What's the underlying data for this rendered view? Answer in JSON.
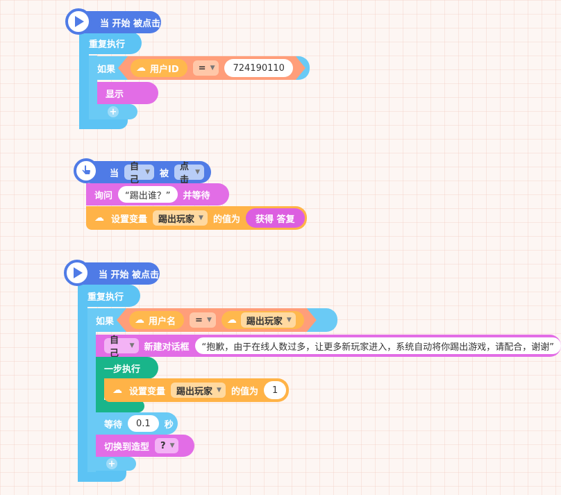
{
  "script1": {
    "hat_label": "当 开始 被点击",
    "repeat_label": "重复执行",
    "if_label": "如果",
    "var_name": "用户ID",
    "operator": "=",
    "compare_value": "724190110",
    "show_label": "显示"
  },
  "script2": {
    "when_label": "当",
    "target_dropdown": "自己",
    "is_label": "被",
    "action_dropdown": "点击",
    "ask_label": "询问",
    "ask_text": "“踢出谁？”",
    "ask_wait_label": "并等待",
    "set_var_label": "设置变量",
    "set_var_name": "踢出玩家",
    "value_label": "的值为",
    "answer_label": "获得 答复"
  },
  "script3": {
    "hat_label": "当 开始 被点击",
    "repeat_label": "重复执行",
    "if_label": "如果",
    "var_name": "用户名",
    "operator": "=",
    "compare_var": "踢出玩家",
    "dialog_target": "自己",
    "dialog_label": "新建对话框",
    "dialog_text": "“抱歉，由于在线人数过多，让更多新玩家进入，系统自动将你踢出游戏，请配合，谢谢”",
    "step_label": "一步执行",
    "set_var_label": "设置变量",
    "set_var_name": "踢出玩家",
    "value_label": "的值为",
    "set_value": "1",
    "wait_label": "等待",
    "wait_value": "0.1",
    "wait_unit": "秒",
    "switch_label": "切换到造型",
    "costume_value": "?"
  },
  "icons": {
    "play": "play-icon",
    "hand": "hand-pointer-icon",
    "cloud": "cloud-upload-icon",
    "add": "plus-icon",
    "dropdown": "chevron-down-icon"
  },
  "colors": {
    "event": "#4f7be6",
    "control": "#5cc3f4",
    "operator": "#ff9e7a",
    "variable": "#ffb347",
    "looks": "#e26de6",
    "step": "#19b58a"
  }
}
